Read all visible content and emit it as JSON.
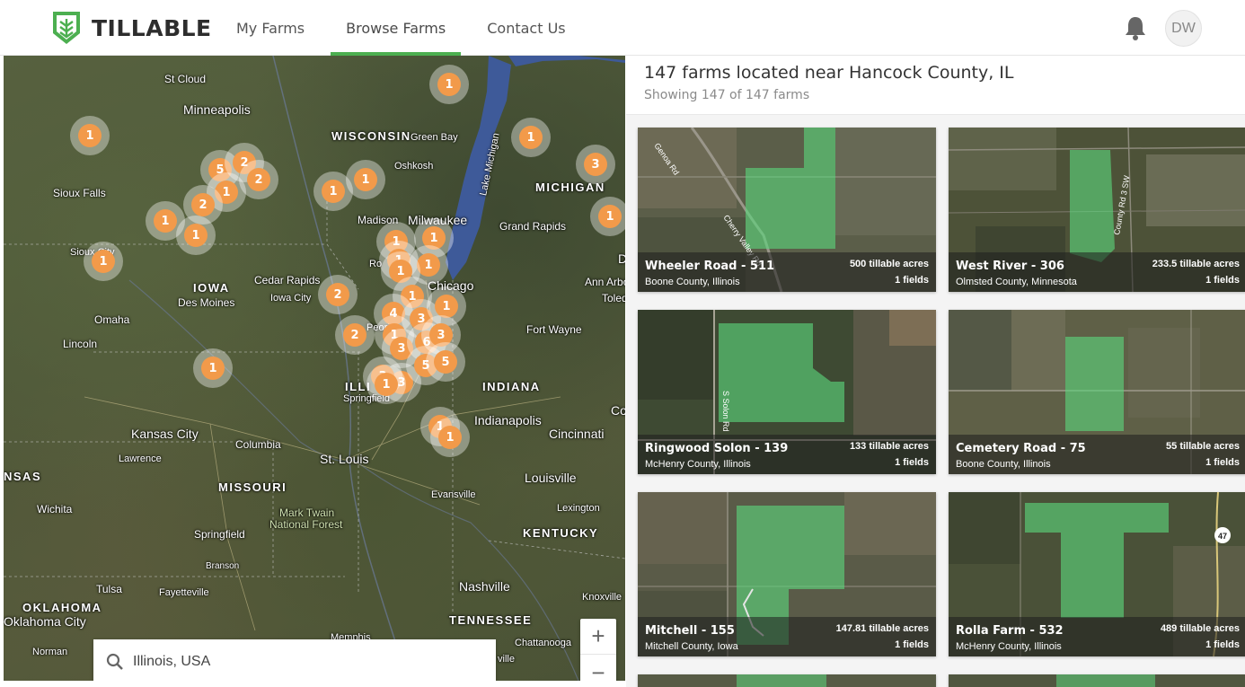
{
  "header": {
    "logo_text": "TILLABLE",
    "nav": [
      {
        "label": "My Farms",
        "active": false
      },
      {
        "label": "Browse Farms",
        "active": true
      },
      {
        "label": "Contact Us",
        "active": false
      }
    ],
    "avatar_initials": "DW",
    "icons": [
      "tillable-logo-icon",
      "bell-icon"
    ]
  },
  "colors": {
    "brand_green": "#4caf50",
    "cluster_orange": "#f29a4a",
    "field_green": "#5cd67c"
  },
  "map": {
    "labels": {
      "st_cloud": "St Cloud",
      "minneapolis": "Minneapolis",
      "wisconsin": "WISCONSIN",
      "green_bay": "Green Bay",
      "oshkosh": "Oshkosh",
      "sioux_falls": "Sioux Falls",
      "sioux_city": "Sioux City",
      "madison": "Madison",
      "milwaukee": "Milwaukee",
      "grand_rapids": "Grand Rapids",
      "michigan": "MICHIGAN",
      "lake_michigan": "Lake Michigan",
      "iowa": "IOWA",
      "des_moines": "Des Moines",
      "cedar_rapids": "Cedar Rapids",
      "iowa_city": "Iowa City",
      "omaha": "Omaha",
      "lincoln": "Lincoln",
      "chicago": "Chicago",
      "ann_arbor": "Ann Arbor",
      "toledo": "Toled",
      "rockford": "Ro",
      "fort_wayne": "Fort Wayne",
      "peoria": "Peoria",
      "illinois": "ILLI",
      "springfield_il": "Springfield",
      "indiana": "INDIANA",
      "indianapolis": "Indianapolis",
      "columbus_cut": "Co",
      "cincinnati": "Cincinnati",
      "kansas_city": "Kansas City",
      "lawrence": "Lawrence",
      "columbia": "Columbia",
      "st_louis": "St. Louis",
      "kansas_cut": "NSAS",
      "missouri": "MISSOURI",
      "louisville": "Louisville",
      "evansville": "Evansville",
      "wichita": "Wichita",
      "mark_twain": "Mark Twain",
      "national_forest": "National Forest",
      "lexington": "Lexington",
      "springfield_mo": "Springfield",
      "kentucky": "KENTUCKY",
      "branson": "Branson",
      "tulsa": "Tulsa",
      "fayetteville": "Fayetteville",
      "nashville": "Nashville",
      "knoxville": "Knoxville",
      "oklahoma": "OKLAHOMA",
      "oklahoma_city": "Oklahoma City",
      "tennessee": "TENNESSEE",
      "memphis": "Memphis",
      "chattanooga": "Chattanooga",
      "norman": "Norman",
      "nashville_cut": "ville",
      "detroit_cut": "D"
    },
    "clusters": [
      "1",
      "1",
      "1",
      "3",
      "5",
      "2",
      "2",
      "1",
      "2",
      "1",
      "1",
      "1",
      "1",
      "1",
      "1",
      "1",
      "1",
      "1",
      "1",
      "1",
      "1",
      "2",
      "4",
      "3",
      "1",
      "2",
      "1",
      "3",
      "6",
      "3",
      "3",
      "5",
      "5",
      "3",
      "1",
      "1",
      "1",
      "1"
    ],
    "zoom_in": "+",
    "zoom_out": "−",
    "search": {
      "value": "Illinois, USA",
      "icon": "search-icon"
    }
  },
  "panel": {
    "title": "147 farms located near Hancock County, IL",
    "subtitle": "Showing 147 of 147 farms",
    "farms": [
      {
        "name": "Wheeler Road - 511",
        "location": "Boone County, Illinois",
        "acres": "500 tillable acres",
        "fields": "1 fields"
      },
      {
        "name": "West River - 306",
        "location": "Olmsted County, Minnesota",
        "acres": "233.5 tillable acres",
        "fields": "1 fields"
      },
      {
        "name": "Ringwood Solon - 139",
        "location": "McHenry County, Illinois",
        "acres": "133 tillable acres",
        "fields": "1 fields"
      },
      {
        "name": "Cemetery Road - 75",
        "location": "Boone County, Illinois",
        "acres": "55 tillable acres",
        "fields": "1 fields"
      },
      {
        "name": "Mitchell - 155",
        "location": "Mitchell County, Iowa",
        "acres": "147.81 tillable acres",
        "fields": "1 fields"
      },
      {
        "name": "Rolla Farm - 532",
        "location": "McHenry County, Illinois",
        "acres": "489 tillable acres",
        "fields": "1 fields"
      }
    ],
    "aerial_labels": {
      "genoa_rd": "Genoa Rd",
      "cherry_valley": "Cherry Valley Rd",
      "county_rd_3": "County Rd 3 SW",
      "solon_rd": "S Solon Rd",
      "hwy47": "47"
    }
  }
}
